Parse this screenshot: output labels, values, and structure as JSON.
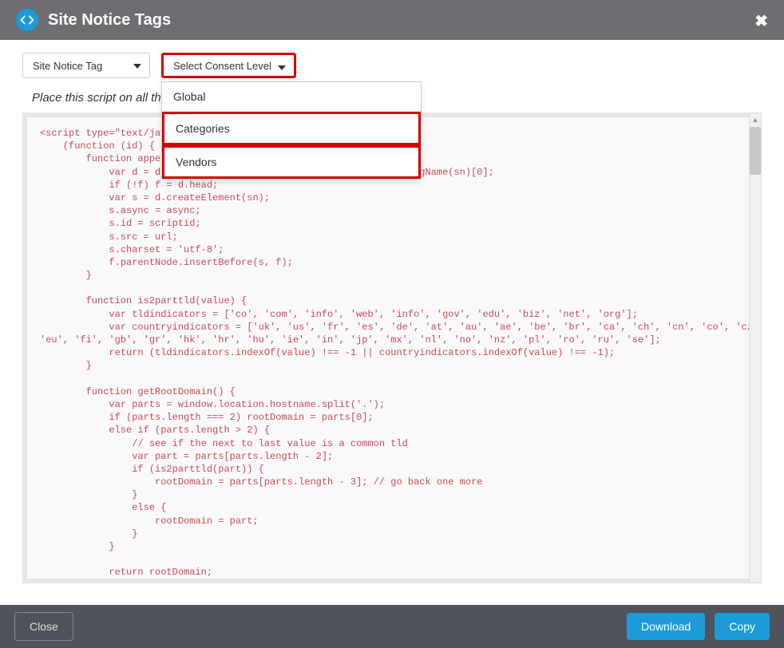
{
  "header": {
    "title": "Site Notice Tags"
  },
  "dropdown1": {
    "label": "Site Notice Tag"
  },
  "dropdown2": {
    "label": "Select Consent Level",
    "options": {
      "global": "Global",
      "categories": "Categories",
      "vendors": "Vendors"
    }
  },
  "instruction": "Place this script on all the pages that will use this Site Notice.",
  "code": "<script type=\"text/javascript\">\n    (function (id) {\n        function append(scriptid, url, async) {\n            var d = document, sn = 'script', f = d.getElementsByTagName(sn)[0];\n            if (!f) f = d.head;\n            var s = d.createElement(sn);\n            s.async = async;\n            s.id = scriptid;\n            s.src = url;\n            s.charset = 'utf-8';\n            f.parentNode.insertBefore(s, f);\n        }\n\n        function is2parttld(value) {\n            var tldindicators = ['co', 'com', 'info', 'web', 'info', 'gov', 'edu', 'biz', 'net', 'org'];\n            var countryindicators = ['uk', 'us', 'fr', 'es', 'de', 'at', 'au', 'ae', 'be', 'br', 'ca', 'ch', 'cn', 'co', 'cz', 'dk', 'eg',\n'eu', 'fi', 'gb', 'gr', 'hk', 'hr', 'hu', 'ie', 'in', 'jp', 'mx', 'nl', 'no', 'nz', 'pl', 'ro', 'ru', 'se'];\n            return (tldindicators.indexOf(value) !== -1 || countryindicators.indexOf(value) !== -1);\n        }\n\n        function getRootDomain() {\n            var parts = window.location.hostname.split('.');\n            if (parts.length === 2) rootDomain = parts[0];\n            else if (parts.length > 2) {\n                // see if the next to last value is a common tld\n                var part = parts[parts.length - 2];\n                if (is2parttld(part)) {\n                    rootDomain = parts[parts.length - 3]; // go back one more\n                }\n                else {\n                    rootDomain = part;\n                }\n            }\n\n            return rootDomain;\n",
  "footer": {
    "close": "Close",
    "download": "Download",
    "copy": "Copy"
  }
}
